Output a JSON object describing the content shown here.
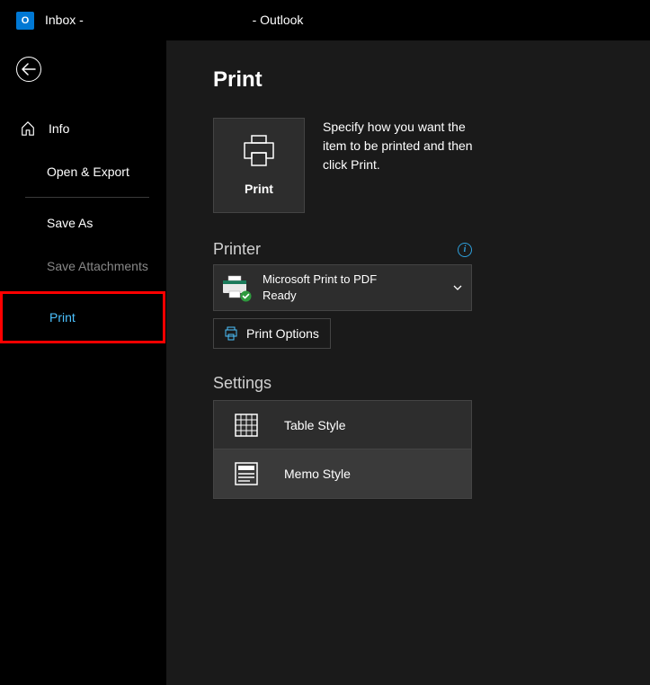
{
  "window": {
    "title_prefix": "Inbox - ",
    "title_suffix": "-  Outlook",
    "app_abbr": "O"
  },
  "sidebar": {
    "info": "Info",
    "open_export": "Open & Export",
    "save_as": "Save As",
    "save_attachments": "Save Attachments",
    "print": "Print"
  },
  "page": {
    "heading": "Print",
    "print_button": "Print",
    "description": "Specify how you want the item to be printed and then click Print."
  },
  "printer_section": {
    "label": "Printer",
    "selected_name": "Microsoft Print to PDF",
    "selected_status": "Ready",
    "options_button": "Print Options"
  },
  "settings_section": {
    "label": "Settings",
    "styles": {
      "table": "Table Style",
      "memo": "Memo Style"
    }
  }
}
